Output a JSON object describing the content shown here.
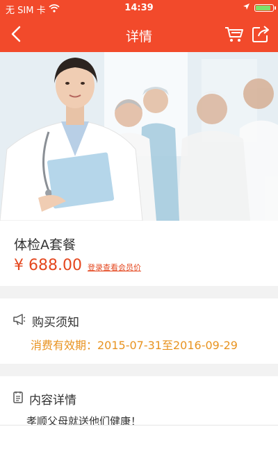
{
  "status_bar": {
    "carrier": "无 SIM 卡",
    "time": "14:39",
    "battery_level": 0.9
  },
  "nav": {
    "title": "详情"
  },
  "product": {
    "name": "体检A套餐",
    "price": "¥ 688.00",
    "member_price_link": "登录查看会员价"
  },
  "purchase_notice": {
    "heading": "购买须知",
    "validity": "消费有效期：2015-07-31至2016-09-29"
  },
  "content_details": {
    "heading": "内容详情",
    "text": "孝顺父母就送他们健康！"
  },
  "colors": {
    "brand": "#f24a2b",
    "price": "#e4471f",
    "validity": "#e89320"
  }
}
